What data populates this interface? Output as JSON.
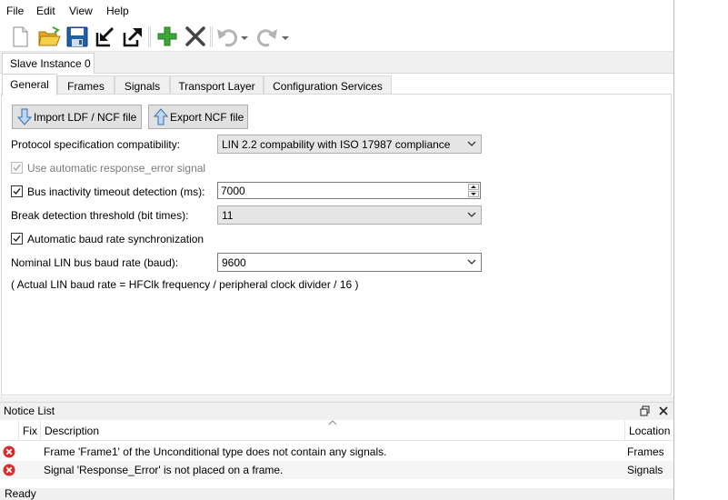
{
  "menu": {
    "items": [
      "File",
      "Edit",
      "View",
      "Help"
    ]
  },
  "toolbar": {
    "buttons": [
      "new-file-icon",
      "open-folder-icon",
      "save-icon",
      "import-icon",
      "export-icon",
      "add-icon",
      "delete-icon",
      "undo-icon",
      "redo-icon"
    ]
  },
  "document_tab": {
    "label": "Slave Instance 0"
  },
  "tabs": [
    "General",
    "Frames",
    "Signals",
    "Transport Layer",
    "Configuration Services"
  ],
  "general": {
    "import_button": "Import LDF / NCF file",
    "export_button": "Export NCF file",
    "protocol_label": "Protocol specification compatibility:",
    "protocol_value": "LIN 2.2 compability with ISO 17987 compliance",
    "response_error_label": "Use automatic response_error signal",
    "response_error_checked": true,
    "inactivity_label": "Bus inactivity timeout detection (ms):",
    "inactivity_checked": true,
    "inactivity_value": "7000",
    "break_label": "Break detection threshold (bit times):",
    "break_value": "11",
    "auto_baud_label": "Automatic baud rate synchronization",
    "auto_baud_checked": true,
    "baud_label": "Nominal LIN bus baud rate (baud):",
    "baud_value": "9600",
    "baud_note": "( Actual LIN baud rate = HFClk frequency / peripheral clock divider / 16 )"
  },
  "notice_list": {
    "title": "Notice List",
    "columns": {
      "fix": "Fix",
      "description": "Description",
      "location": "Location"
    },
    "rows": [
      {
        "description": "Frame 'Frame1' of the Unconditional type does not contain any signals.",
        "location": "Frames"
      },
      {
        "description": "Signal 'Response_Error' is not placed on a frame.",
        "location": "Signals"
      }
    ]
  },
  "status": {
    "text": "Ready"
  },
  "colors": {
    "error": "#d32f2f",
    "add": "#3aa635",
    "folder": "#f2c12e",
    "save": "#1f5fa8"
  }
}
